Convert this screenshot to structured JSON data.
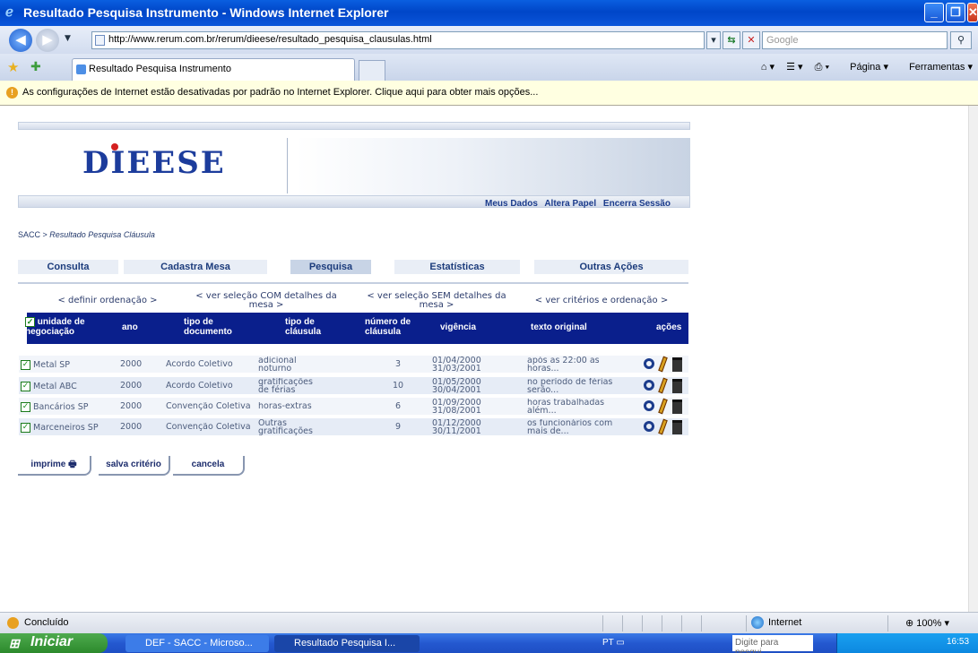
{
  "window": {
    "title": "Resultado Pesquisa Instrumento - Windows Internet Explorer"
  },
  "addressbar": {
    "url": "http://www.rerum.com.br/rerum/dieese/resultado_pesquisa_clausulas.html",
    "search_placeholder": "Google"
  },
  "tabs": {
    "active": "Resultado Pesquisa Instrumento"
  },
  "command_bar": {
    "page": "Página",
    "tools": "Ferramentas"
  },
  "infobar": {
    "text": "As configurações de Internet estão desativadas por padrão no Internet Explorer. Clique aqui para obter mais opções..."
  },
  "site": {
    "logo": "DIEESE",
    "user_links": [
      "Meus Dados",
      "Altera Papel",
      "Encerra Sessão"
    ],
    "breadcrumb_root": "SACC > ",
    "breadcrumb_page": "Resultado Pesquisa Cláusula",
    "menu": [
      "Consulta",
      "Cadastra Mesa",
      "Pesquisa",
      "Estatísticas",
      "Outras Ações"
    ],
    "options": [
      "< definir ordenação >",
      "< ver seleção COM detalhes da mesa >",
      "< ver seleção SEM detalhes da mesa >",
      "< ver critérios e ordenação >"
    ]
  },
  "table": {
    "headers": {
      "unidade": "unidade de negociação",
      "ano": "ano",
      "tipo_documento": "tipo de documento",
      "tipo_clausula": "tipo de cláusula",
      "numero": "número de cláusula",
      "vigencia": "vigência",
      "texto": "texto original",
      "acoes": "ações"
    },
    "rows": [
      {
        "unidade": "Metal SP",
        "ano": "2000",
        "documento": "Acordo Coletivo",
        "clausula1": "adicional",
        "clausula2": "noturno",
        "numero": "3",
        "vig1": "01/04/2000",
        "vig2": "31/03/2001",
        "texto1": "após as 22:00 as",
        "texto2": "horas..."
      },
      {
        "unidade": "Metal ABC",
        "ano": "2000",
        "documento": "Acordo Coletivo",
        "clausula1": "gratificações",
        "clausula2": "de férias",
        "numero": "10",
        "vig1": "01/05/2000",
        "vig2": "30/04/2001",
        "texto1": "no período de férias",
        "texto2": "serão..."
      },
      {
        "unidade": "Bancários SP",
        "ano": "2000",
        "documento": "Convenção Coletiva",
        "clausula1": "horas-extras",
        "clausula2": "",
        "numero": "6",
        "vig1": "01/09/2000",
        "vig2": "31/08/2001",
        "texto1": "horas trabalhadas",
        "texto2": "além..."
      },
      {
        "unidade": "Marceneiros SP",
        "ano": "2000",
        "documento": "Convenção Coletiva",
        "clausula1": "Outras",
        "clausula2": "gratificações",
        "numero": "9",
        "vig1": "01/12/2000",
        "vig2": "30/11/2001",
        "texto1": "os funcionários com",
        "texto2": "mais de..."
      }
    ]
  },
  "buttons": {
    "imprime": "imprime",
    "salva": "salva critério",
    "cancela": "cancela"
  },
  "statusbar": {
    "status": "Concluído",
    "zone": "Internet",
    "zoom": "100%"
  },
  "taskbar": {
    "start": "Iniciar",
    "items": [
      "DEF - SACC - Microso...",
      "Resultado Pesquisa I..."
    ],
    "lang": "PT",
    "search": "Digite para pesqui...",
    "clock": "16:53"
  }
}
